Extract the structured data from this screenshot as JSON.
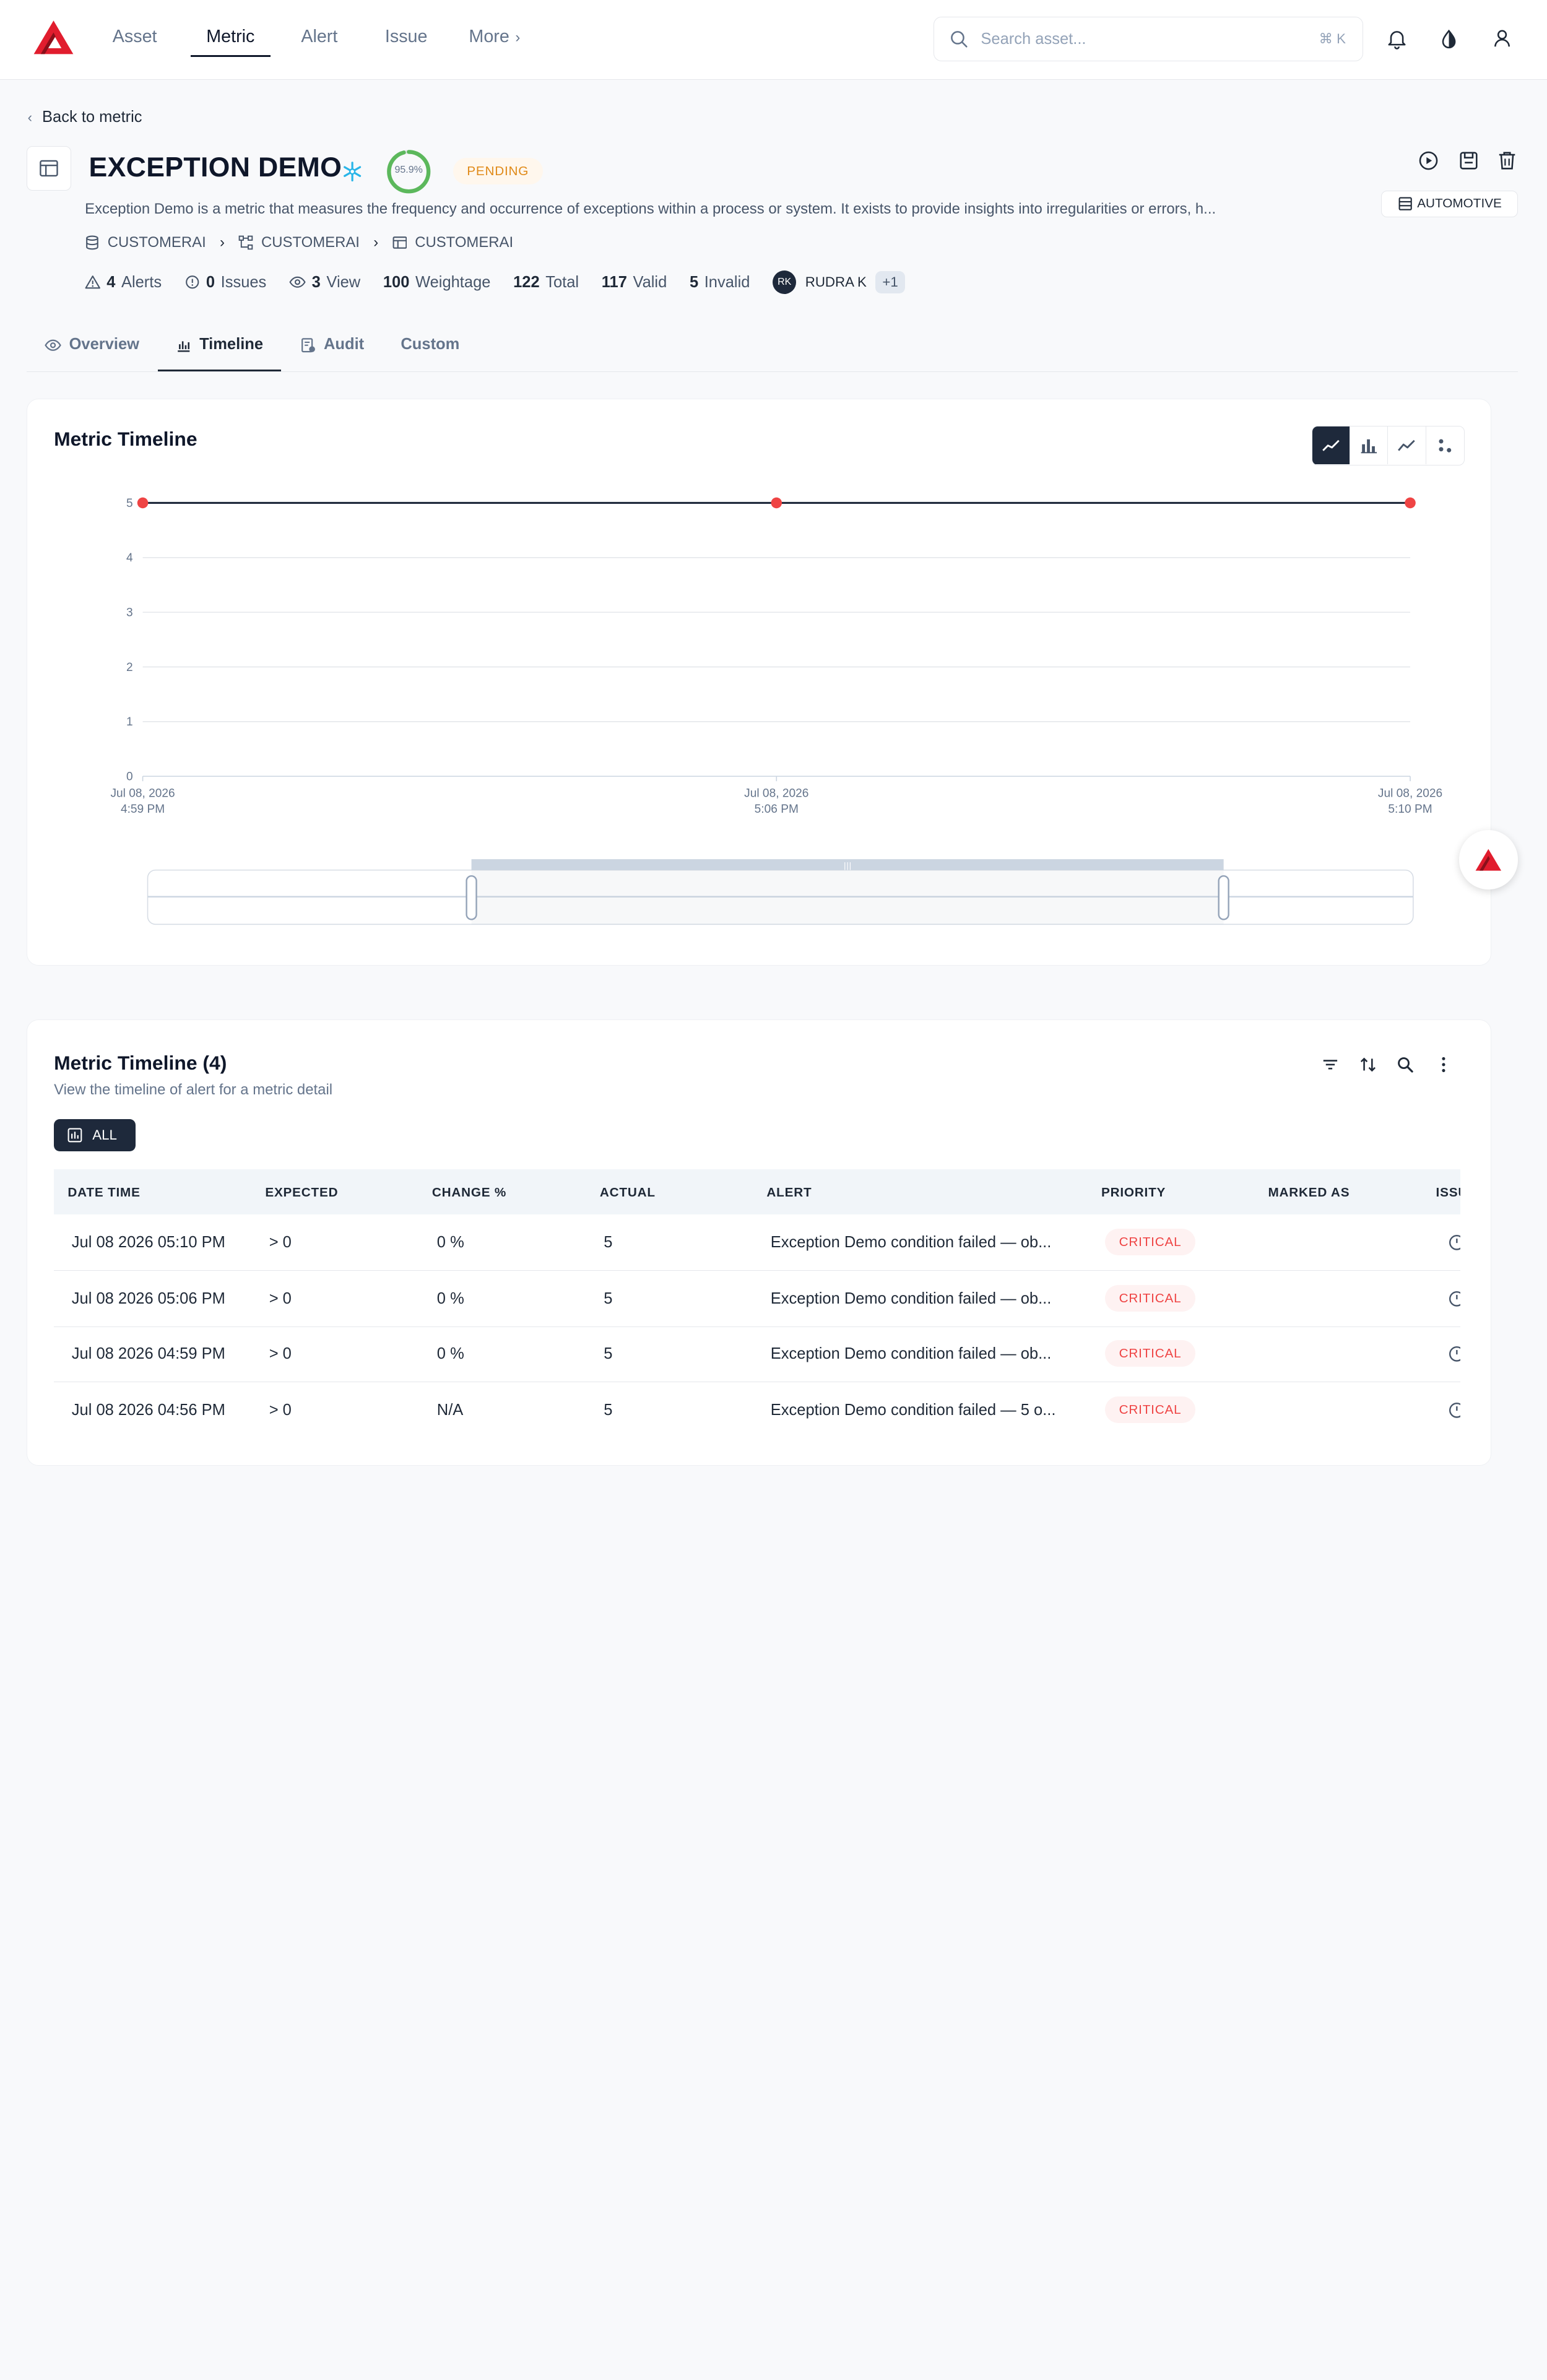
{
  "nav": {
    "links": [
      "Asset",
      "Metric",
      "Alert",
      "Issue"
    ],
    "more_label": "More",
    "search_placeholder": "Search asset...",
    "search_shortcut": "⌘ K"
  },
  "header": {
    "back_label": "Back to metric",
    "title": "EXCEPTION DEMO",
    "score": "95.9%",
    "score_fraction": 0.959,
    "status": "PENDING",
    "domain_tag": "AUTOMOTIVE",
    "description": "Exception Demo is a metric that measures the frequency and occurrence of exceptions within a process or system. It exists to provide insights into irregularities or errors, h...",
    "breadcrumbs": [
      "CUSTOMERAI",
      "CUSTOMERAI",
      "CUSTOMERAI"
    ],
    "stats": {
      "alerts_count": "4",
      "alerts_label": "Alerts",
      "issues_count": "0",
      "issues_label": "Issues",
      "views_count": "3",
      "views_label": "View",
      "weightage_count": "100",
      "weightage_label": "Weightage",
      "total_count": "122",
      "total_label": "Total",
      "valid_count": "117",
      "valid_label": "Valid",
      "invalid_count": "5",
      "invalid_label": "Invalid"
    },
    "owner_initials": "RK",
    "owner_name": "RUDRA K",
    "extra_owners": "+1"
  },
  "tabs": [
    "Overview",
    "Timeline",
    "Audit",
    "Custom"
  ],
  "chart_card": {
    "title": "Metric Timeline"
  },
  "chart_data": {
    "type": "line",
    "x": [
      [
        "Jul 08, 2026",
        "4:59 PM"
      ],
      [
        "Jul 08, 2026",
        "5:06 PM"
      ],
      [
        "Jul 08, 2026",
        "5:10 PM"
      ]
    ],
    "values": [
      5,
      5,
      5
    ],
    "ylim": [
      0,
      5
    ],
    "yticks": [
      0,
      1,
      2,
      3,
      4,
      5
    ],
    "grid": true,
    "colors": {
      "line": "#1e293b",
      "point": "#ef4444"
    }
  },
  "table_card": {
    "title": "Metric Timeline (4)",
    "subtitle": "View the timeline of alert for a metric detail",
    "filter_label": "ALL",
    "columns": [
      "DATE TIME",
      "EXPECTED",
      "CHANGE %",
      "ACTUAL",
      "ALERT",
      "PRIORITY",
      "MARKED AS",
      "ISSUE"
    ],
    "rows": [
      {
        "datetime": "Jul 08 2026 05:10 PM",
        "expected": "> 0",
        "change": "0 %",
        "actual": "5",
        "alert": "Exception Demo condition failed — ob...",
        "priority": "CRITICAL"
      },
      {
        "datetime": "Jul 08 2026 05:06 PM",
        "expected": "> 0",
        "change": "0 %",
        "actual": "5",
        "alert": "Exception Demo condition failed — ob...",
        "priority": "CRITICAL"
      },
      {
        "datetime": "Jul 08 2026 04:59 PM",
        "expected": "> 0",
        "change": "0 %",
        "actual": "5",
        "alert": "Exception Demo condition failed — ob...",
        "priority": "CRITICAL"
      },
      {
        "datetime": "Jul 08 2026 04:56 PM",
        "expected": "> 0",
        "change": "N/A",
        "actual": "5",
        "alert": "Exception Demo condition failed — 5 o...",
        "priority": "CRITICAL"
      }
    ]
  },
  "colors": {
    "brand": "#e11d2e",
    "accent_dark": "#1e293b",
    "pending": "#e08a19",
    "critical": "#ef4444",
    "score_ring": "#5cb85c"
  },
  "icons": [
    "search-icon",
    "bell-icon",
    "theme-icon",
    "user-icon",
    "play-icon",
    "save-icon",
    "trash-icon",
    "filter-icon",
    "sort-icon",
    "kebab-icon"
  ]
}
